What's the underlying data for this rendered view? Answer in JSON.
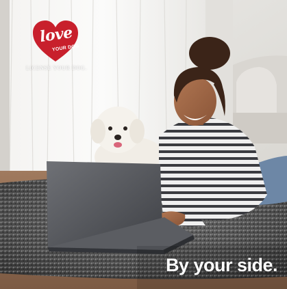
{
  "logo": {
    "word": "love",
    "subtext": "YOUR DOG",
    "tagline": "LICENSE YOUR DOG.",
    "heart_color": "#c8202c"
  },
  "slogan": "By your side."
}
